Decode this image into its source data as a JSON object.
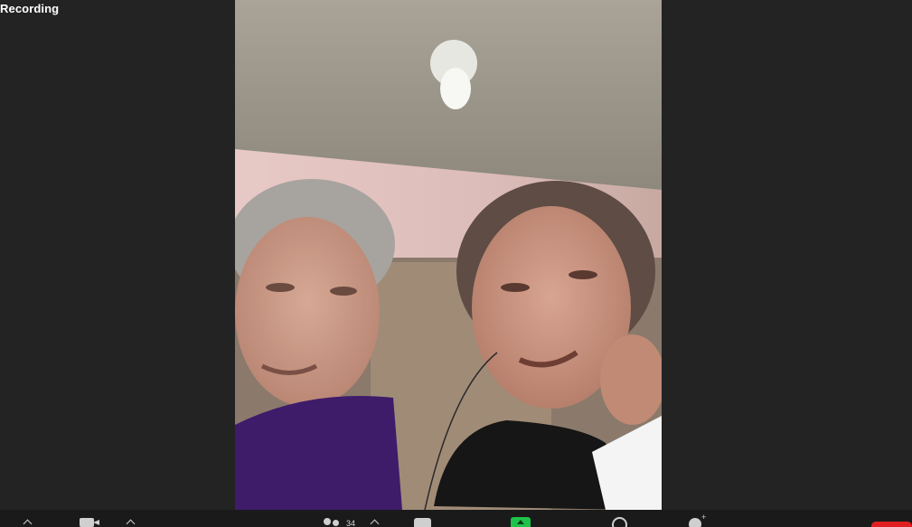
{
  "recording": {
    "label": "Recording"
  },
  "participants": {
    "count": "34"
  },
  "colors": {
    "background": "#232323",
    "toolbar": "#1a1a1a",
    "share_green": "#1fc24a",
    "end_red": "#e02020"
  },
  "toolbar_icons": [
    "mute-caret-icon",
    "video-camera-icon",
    "video-caret-icon",
    "participants-icon",
    "participants-caret-icon",
    "chat-icon",
    "share-screen-icon",
    "record-icon",
    "reactions-icon",
    "end-button"
  ]
}
